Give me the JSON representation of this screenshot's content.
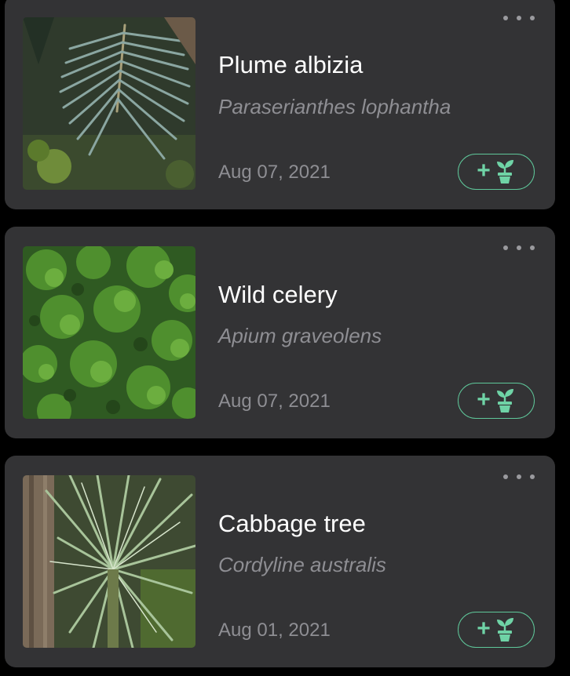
{
  "plants": [
    {
      "common_name": "Plume albizia",
      "scientific_name": "Paraserianthes lophantha",
      "date": "Aug 07, 2021",
      "photo_icon": "fern-frond-photo"
    },
    {
      "common_name": "Wild celery",
      "scientific_name": "Apium graveolens",
      "date": "Aug 07, 2021",
      "photo_icon": "celery-leaves-photo"
    },
    {
      "common_name": "Cabbage tree",
      "scientific_name": "Cordyline australis",
      "date": "Aug 01, 2021",
      "photo_icon": "cabbage-tree-photo"
    }
  ],
  "icons": {
    "more": "more-options-icon",
    "add_to_garden": "add-plant-to-garden-icon"
  },
  "colors": {
    "background": "#000000",
    "card": "#333335",
    "accent": "#5fc79a",
    "primary_text": "#ffffff",
    "secondary_text": "#8e8e93"
  }
}
